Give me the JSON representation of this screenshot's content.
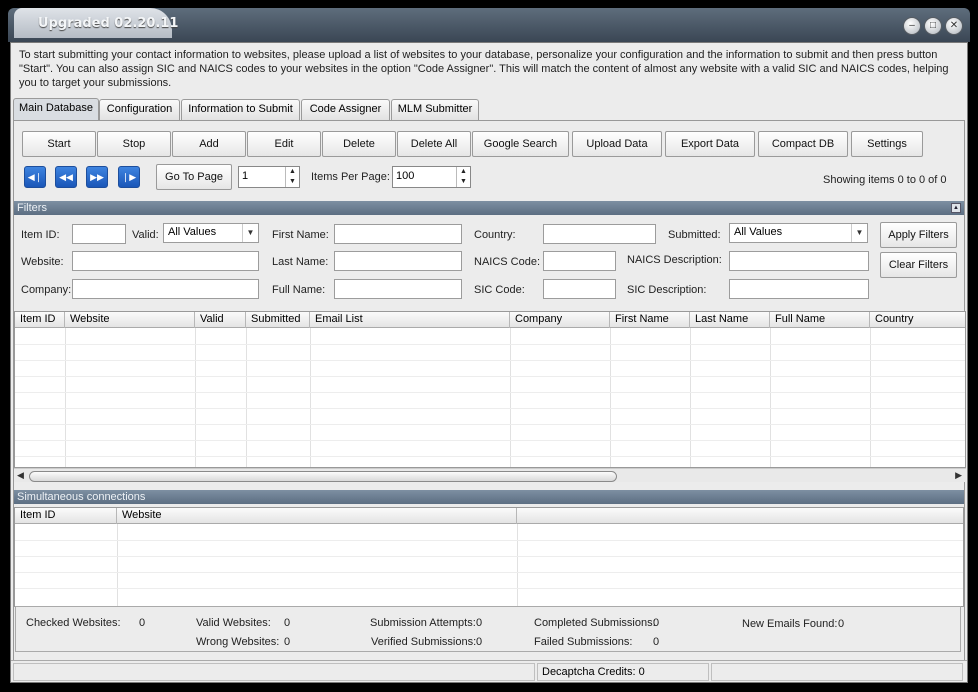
{
  "window": {
    "title": "Upgraded 02.20.11"
  },
  "intro_text": "To start submitting your contact information to websites, please upload a list of websites to your database, personalize your configuration and the information to submit and then press button \"Start\". You can also assign SIC and NAICS codes to your websites in the option \"Code Assigner\". This will match the content of almost any website with a valid SIC and NAICS codes, helping you to target your submissions.",
  "tabs": [
    "Main Database",
    "Configuration",
    "Information to Submit",
    "Code Assigner",
    "MLM Submitter"
  ],
  "toolbar": [
    "Start",
    "Stop",
    "Add",
    "Edit",
    "Delete",
    "Delete All",
    "Google Search",
    "Upload Data",
    "Export Data",
    "Compact DB",
    "Settings"
  ],
  "paging": {
    "go_to_page_label": "Go To Page",
    "page_value": "1",
    "items_per_page_label": "Items Per Page:",
    "items_per_page_value": "100",
    "showing": "Showing items 0 to 0 of 0"
  },
  "filters": {
    "title": "Filters",
    "item_id_label": "Item ID:",
    "valid_label": "Valid:",
    "valid_value": "All Values",
    "first_name_label": "First Name:",
    "country_label": "Country:",
    "submitted_label": "Submitted:",
    "submitted_value": "All Values",
    "website_label": "Website:",
    "last_name_label": "Last Name:",
    "naics_code_label": "NAICS Code:",
    "naics_desc_label": "NAICS Description:",
    "company_label": "Company:",
    "full_name_label": "Full Name:",
    "sic_code_label": "SIC Code:",
    "sic_desc_label": "SIC Description:",
    "apply_button": "Apply Filters",
    "clear_button": "Clear Filters"
  },
  "main_grid": {
    "columns": [
      "Item ID",
      "Website",
      "Valid",
      "Submitted",
      "Email List",
      "Company",
      "First Name",
      "Last Name",
      "Full Name",
      "Country"
    ]
  },
  "connections": {
    "title": "Simultaneous connections",
    "columns": [
      "Item ID",
      "Website"
    ]
  },
  "stats": {
    "checked_label": "Checked Websites:",
    "checked_value": "0",
    "valid_label": "Valid Websites:",
    "valid_value": "0",
    "wrong_label": "Wrong Websites:",
    "wrong_value": "0",
    "attempts_label": "Submission Attempts:",
    "attempts_value": "0",
    "verified_label": "Verified Submissions:",
    "verified_value": "0",
    "completed_label": "Completed Submissions:",
    "completed_value": "0",
    "failed_label": "Failed Submissions:",
    "failed_value": "0",
    "new_emails_label": "New Emails Found:",
    "new_emails_value": "0"
  },
  "status": {
    "decaptcha": "Decaptcha Credits: 0"
  }
}
